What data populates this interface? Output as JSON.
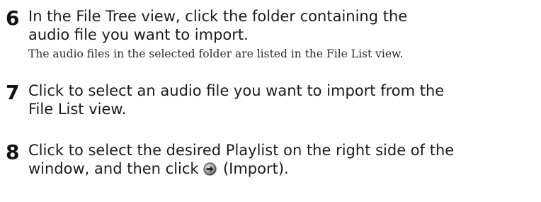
{
  "steps": [
    {
      "number": "6",
      "line1": "In the File Tree view, click the folder containing the",
      "line2": "audio file you want to import.",
      "note": "The audio files in the selected folder are listed in the File List view."
    },
    {
      "number": "7",
      "line1": "Click to select an audio file you want to import from the",
      "line2": "File List view."
    },
    {
      "number": "8",
      "line1": "Click to select the desired Playlist on the right side of the",
      "line2_before_icon": "window, and then click",
      "icon": "import-arrow-icon",
      "line2_after_icon": "(Import)."
    }
  ]
}
